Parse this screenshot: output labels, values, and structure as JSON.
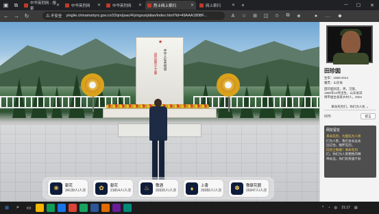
{
  "browser": {
    "tabs": [
      {
        "label": "中华英烈网 - 搜索",
        "active": false
      },
      {
        "label": "中华英烈网",
        "active": false
      },
      {
        "label": "中华英烈网",
        "active": false
      },
      {
        "label": "烈士网上祭扫",
        "active": true
      },
      {
        "label": "网上祭扫",
        "active": false
      }
    ],
    "new_tab": "+",
    "security_warning": "⚠ 不安全",
    "url": "yinglie.chinamartyrs.gov.cn/22qm/jsao/4/yingxunjidian/index.html?id=49AAA180BF..."
  },
  "scene": {
    "monument_text_black": "中华人民共和国",
    "monument_text_red": "田珍囡烈士之墓"
  },
  "actions": [
    {
      "label": "献花",
      "count": "34139人/人次",
      "icon": "flower-icon",
      "glyph": "❀"
    },
    {
      "label": "献花",
      "count": "21814人/人次",
      "icon": "bouquet-icon",
      "glyph": "✿"
    },
    {
      "label": "敬酒",
      "count": "20320人/人次",
      "icon": "wine-icon",
      "glyph": "♨"
    },
    {
      "label": "上香",
      "count": "20282人/人次",
      "icon": "incense-icon",
      "glyph": "♦"
    },
    {
      "label": "敬献花圈",
      "count": "20347人/人次",
      "icon": "wreath-icon",
      "glyph": "✽"
    }
  ],
  "martyr": {
    "name": "田珍囡",
    "life": "生卒：1980-2014",
    "origin": "籍贯：山东省",
    "bio_1": "田珍囡同志，男，汉族，",
    "bio_2": "1980年10月出生，山东省滨",
    "bio_3": "博市桓台县某乡村人，2004",
    "select_label": "革命先烈们，你们为人民 ⌄",
    "page_count": "0/25",
    "message_button": "留言"
  },
  "messages": {
    "title": "网友留言",
    "lines": [
      {
        "text": "革命先烈，为国先为人民",
        "color": "y"
      },
      {
        "text": "们为人民，我们会永远永",
        "color": "w"
      },
      {
        "text": "远记住，缅怀先烈。",
        "color": "w"
      },
      {
        "text": "向烈士致敬！革命先烈",
        "color": "y"
      },
      {
        "text": "们，你们为人民牺牲的精",
        "color": "w"
      },
      {
        "text": "神永远，你们的英雄千秋",
        "color": "w"
      }
    ]
  },
  "tray": {
    "language": "中",
    "time": "21:17"
  }
}
